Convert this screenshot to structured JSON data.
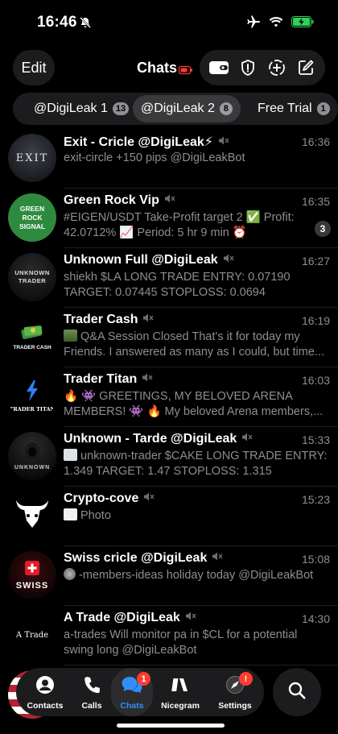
{
  "status": {
    "time": "16:46"
  },
  "header": {
    "edit_label": "Edit",
    "title": "Chats"
  },
  "folders": [
    {
      "label": "@DigiLeak 1",
      "count": "13"
    },
    {
      "label": "@DigiLeak 2",
      "count": "8"
    },
    {
      "label": "Free Trial",
      "count": "1"
    }
  ],
  "chats": [
    {
      "name": "Exit - Cricle @DigiLeak⚡",
      "time": "16:36",
      "message": "exit-circle +150 pips @DigiLeakBot",
      "avatar_text": "EXIT",
      "muted": true
    },
    {
      "name": "Green Rock Vip",
      "time": "16:35",
      "message": "#EIGEN/USDT Take-Profit target 2 ✅ Profit: 42.0712% 📈 Period: 5 hr 9 min ⏰",
      "avatar_text": "GREEN ROCK SIGNAL",
      "unread": "3",
      "muted": true
    },
    {
      "name": "Unknown Full @DigiLeak",
      "time": "16:27",
      "message": "shiekh $LA LONG TRADE ENTRY: 0.07190 TARGET: 0.07445 STOPLOSS: 0.0694 @DigiLea...",
      "avatar_text": "UNKNOWN TRADER",
      "muted": true
    },
    {
      "name": "Trader Cash",
      "time": "16:19",
      "message": "Q&A Session Closed That’s it for today my Friends. I answered as many as I could, but time...",
      "avatar_text": "TRADER CASH",
      "muted": true
    },
    {
      "name": "Trader Titan",
      "time": "16:03",
      "message": "🔥 👾 GREETINGS, MY BELOVED ARENA MEMBERS! 👾 🔥 My beloved Arena members,...",
      "avatar_text": "TRADER TITAN",
      "muted": true
    },
    {
      "name": "Unknown - Tarde @DigiLeak",
      "time": "15:33",
      "message": "unknown-trader $CAKE LONG TRADE ENTRY: 1.349 TARGET: 1.47 STOPLOSS: 1.315 @DigiLea...",
      "avatar_text": "UNKNOWN",
      "muted": true
    },
    {
      "name": "Crypto-cove",
      "time": "15:23",
      "message": "Photo",
      "muted": true
    },
    {
      "name": "Swiss cricle @DigiLeak",
      "time": "15:08",
      "message": "-members-ideas holiday today @DigiLeakBot",
      "avatar_text": "SWISS",
      "muted": true
    },
    {
      "name": "A Trade @DigiLeak",
      "time": "14:30",
      "message": "a-trades Will monitor pa in $CL for a potential swing long @DigiLeakBot",
      "avatar_text": "A Trade",
      "muted": true
    }
  ],
  "tabbar": [
    {
      "label": "Contacts",
      "icon": "person-circle-icon"
    },
    {
      "label": "Calls",
      "icon": "phone-icon"
    },
    {
      "label": "Chats",
      "icon": "chat-bubbles-icon",
      "badge": "1",
      "active": true
    },
    {
      "label": "Nicegram",
      "icon": "nicegram-icon"
    },
    {
      "label": "Settings",
      "icon": "settings-icon",
      "badge": "!"
    }
  ],
  "colors": {
    "accent": "#2f8ff7",
    "badge_red": "#ff3b30",
    "muted_text": "#8e8e93",
    "surface": "#1c1c1e"
  }
}
